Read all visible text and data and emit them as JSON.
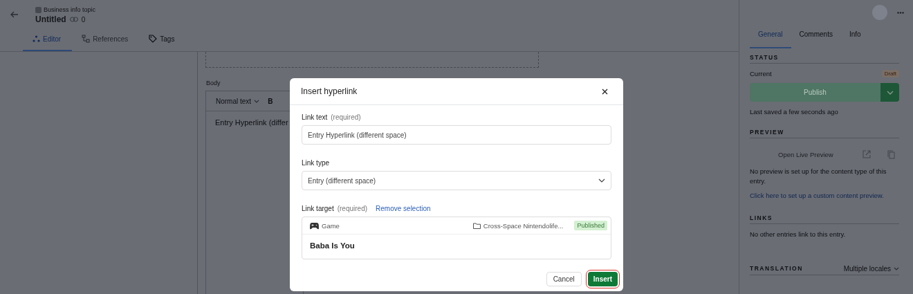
{
  "header": {
    "breadcrumb": "Business info topic",
    "title": "Untitled",
    "link_count": "0"
  },
  "editor_tabs": [
    {
      "kind": "editor",
      "label": "Editor",
      "selected": true,
      "disabled": false
    },
    {
      "kind": "references",
      "label": "References",
      "selected": false,
      "disabled": true
    },
    {
      "kind": "tags",
      "label": "Tags",
      "selected": false,
      "disabled": false
    }
  ],
  "body_field": {
    "label": "Body",
    "style_menu": "Normal text",
    "bold_button": "B",
    "content": "Entry Hyperlink (differ"
  },
  "sidebar": {
    "tabs": [
      {
        "label": "General",
        "selected": true
      },
      {
        "label": "Comments",
        "selected": false
      },
      {
        "label": "Info",
        "selected": false
      }
    ],
    "status": {
      "heading": "STATUS",
      "current_label": "Current",
      "badge": "Draft",
      "publish_button": "Publish",
      "last_saved": "Last saved a few seconds ago"
    },
    "preview": {
      "heading": "PREVIEW",
      "button": "Open Live Preview",
      "message": "No preview is set up for the content type of this entry.",
      "link": "Click here to set up a custom content preview."
    },
    "links": {
      "heading": "LINKS",
      "message": "No other entries link to this entry."
    },
    "translation": {
      "heading": "TRANSLATION",
      "locale_menu": "Multiple locales"
    }
  },
  "dialog": {
    "title": "Insert hyperlink",
    "link_text": {
      "label": "Link text",
      "hint": "(required)",
      "value": "Entry Hyperlink (different space)"
    },
    "link_type": {
      "label": "Link type",
      "value": "Entry (different space)"
    },
    "link_target": {
      "label": "Link target",
      "hint": "(required)",
      "remove_link": "Remove selection",
      "content_type": "Game",
      "space": "Cross-Space Nintendolife...",
      "status": "Published",
      "entry_title": "Baba Is You"
    },
    "buttons": [
      {
        "kind": "secondary",
        "label": "Cancel",
        "highlighted": false
      },
      {
        "kind": "primary",
        "label": "Insert",
        "highlighted": true
      }
    ]
  }
}
